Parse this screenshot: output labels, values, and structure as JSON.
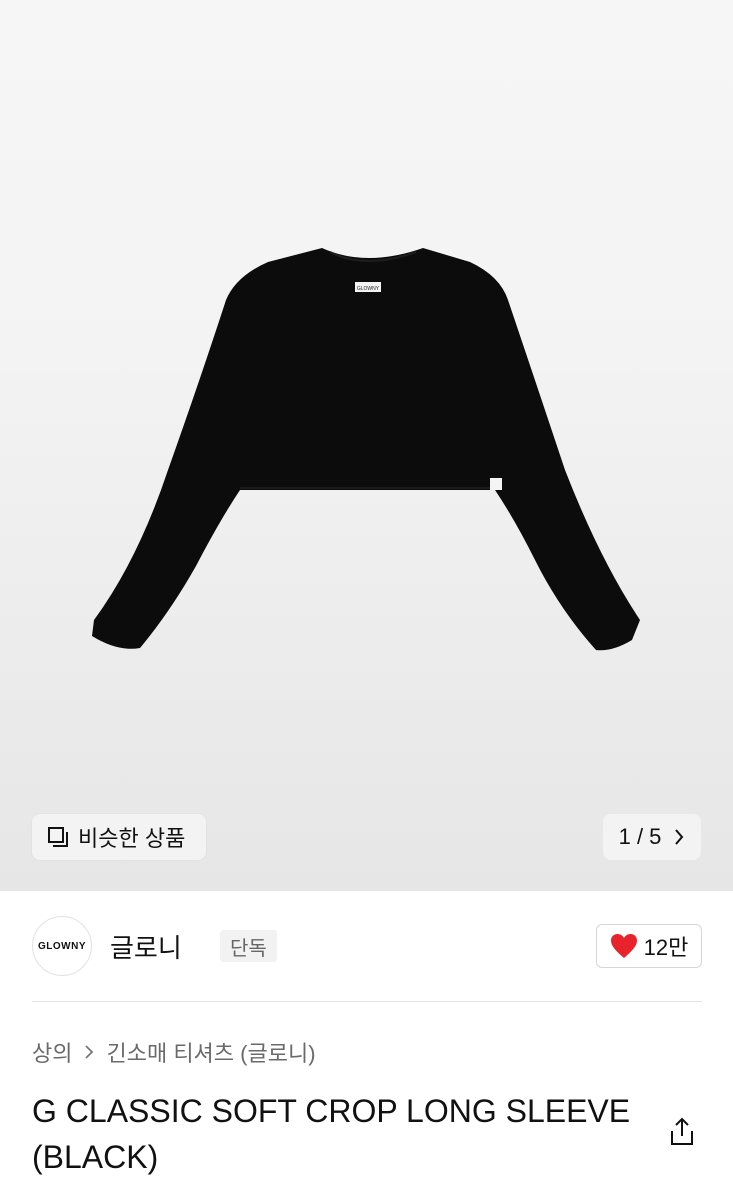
{
  "gallery": {
    "similar_label": "비슷한 상품",
    "page_current": "1",
    "page_total": "5",
    "page_text": "1 / 5",
    "tag_text": "GLOWNY"
  },
  "brand": {
    "logo_text": "GLOWNY",
    "name": "글로니",
    "badge": "단독",
    "like_count": "12만"
  },
  "breadcrumb": {
    "category": "상의",
    "subcategory": "긴소매 티셔츠 (글로니)"
  },
  "product": {
    "title": "G CLASSIC SOFT CROP LONG SLEEVE (BLACK)"
  },
  "colors": {
    "heart": "#e8232b",
    "garment": "#0c0c0c"
  },
  "icons": {
    "similar": "square-stack-icon",
    "next": "chevron-right-icon",
    "like": "heart-icon",
    "share": "share-icon"
  }
}
